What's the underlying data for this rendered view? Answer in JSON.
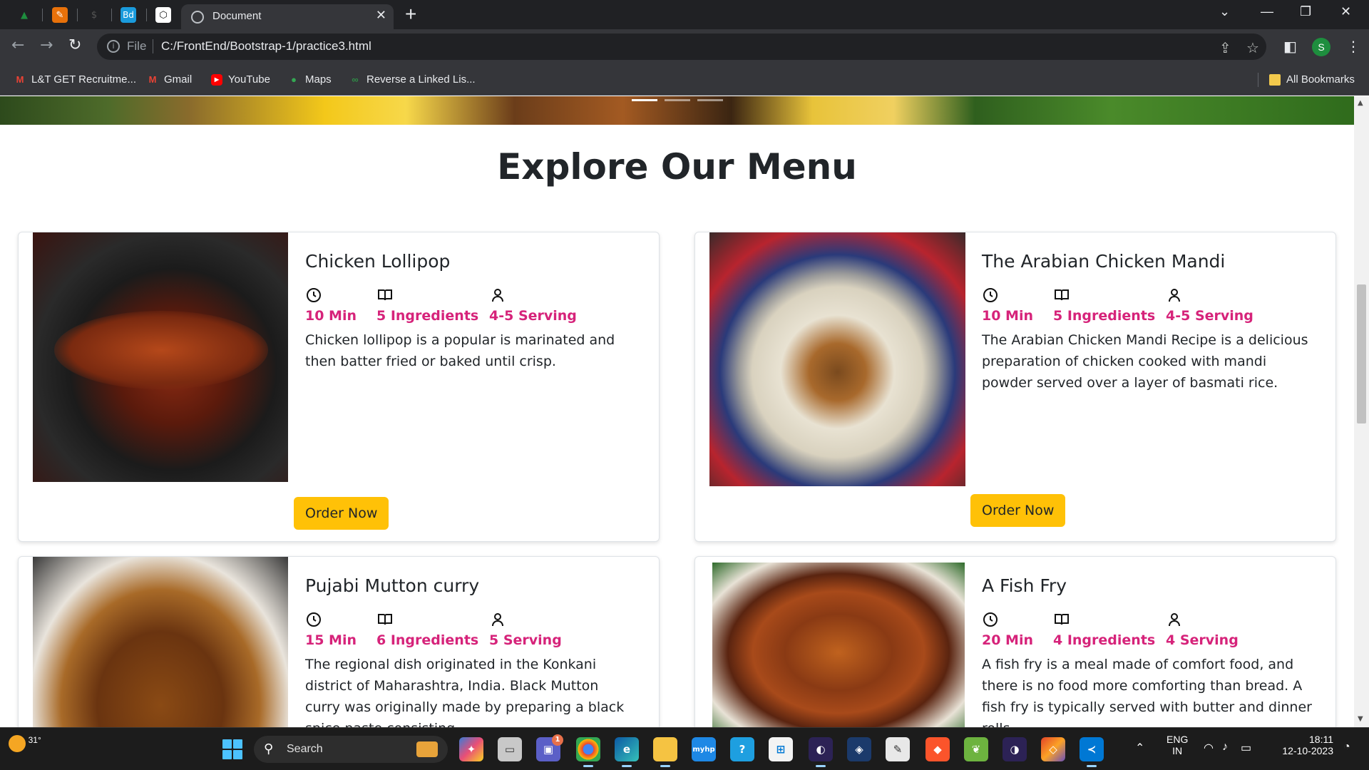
{
  "browser": {
    "active_tab_title": "Document",
    "pinned_tabs": [
      {
        "name": "chart-tab-icon",
        "glyph": "▲",
        "color": "#1e8e3e"
      },
      {
        "name": "pen-tab-icon",
        "glyph": "✎",
        "color": "#e8710a"
      },
      {
        "name": "dark-tab-icon",
        "glyph": "$",
        "color": "#444"
      },
      {
        "name": "bd-tab-icon",
        "glyph": "Bd",
        "color": "#1a9bdc"
      },
      {
        "name": "codepen-tab-icon",
        "glyph": "⬡",
        "color": "#fff"
      }
    ],
    "url_scheme": "File",
    "url": "C:/FrontEnd/Bootstrap-1/practice3.html",
    "profile_initial": "S",
    "bookmarks": [
      {
        "label": "L&T GET Recruitme...",
        "icon": "M",
        "color": "#ea4335"
      },
      {
        "label": "Gmail",
        "icon": "M",
        "color": "#ea4335"
      },
      {
        "label": "YouTube",
        "icon": "▶",
        "color": "#ff0000"
      },
      {
        "label": "Maps",
        "icon": "⬤",
        "color": "#34a853"
      },
      {
        "label": "Reverse a Linked Lis...",
        "icon": "∞",
        "color": "#2f8d46"
      }
    ],
    "all_bookmarks": "All Bookmarks"
  },
  "page": {
    "section_title": "Explore Our Menu",
    "order_label": "Order Now",
    "cards": [
      {
        "title": "Chicken Lollipop",
        "time": "10 Min",
        "ingredients": "5 Ingredients",
        "serving": "4-5 Serving",
        "description": "Chicken lollipop is a popular is marinated and then batter fried or baked until crisp."
      },
      {
        "title": "The Arabian Chicken Mandi",
        "time": "10 Min",
        "ingredients": "5 Ingredients",
        "serving": "4-5 Serving",
        "description": "The Arabian Chicken Mandi Recipe is a delicious preparation of chicken cooked with mandi powder served over a layer of basmati rice."
      },
      {
        "title": "Pujabi Mutton curry",
        "time": "15 Min",
        "ingredients": "6 Ingredients",
        "serving": "5 Serving",
        "description": "The regional dish originated in the Konkani district of Maharashtra, India. Black Mutton curry was originally made by preparing a black spice paste consisting"
      },
      {
        "title": "A Fish Fry",
        "time": "20 Min",
        "ingredients": "4 Ingredients",
        "serving": "4 Serving",
        "description": "A fish fry is a meal made of comfort food, and there is no food more comforting than bread. A fish fry is typically served with butter and dinner rolls."
      }
    ]
  },
  "taskbar": {
    "temperature": "31°",
    "search_placeholder": "Search",
    "language_line1": "ENG",
    "language_line2": "IN",
    "time": "18:11",
    "date": "12-10-2023",
    "teams_badge": "1"
  },
  "colors": {
    "accent_pink": "#d6237a",
    "button_yellow": "#ffc107"
  }
}
